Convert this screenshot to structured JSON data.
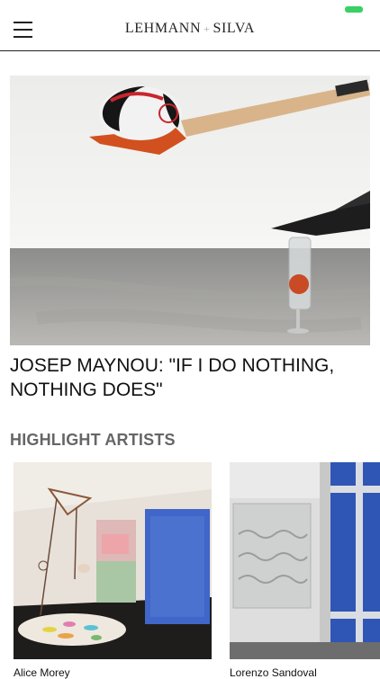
{
  "header": {
    "brand_left": "LEHMANN",
    "brand_sep": "+",
    "brand_right": "SILVA",
    "menu_icon": "hamburger-menu-icon"
  },
  "hero": {
    "title": "JOSEP MAYNOU: \"IF I DO NOTHING, NOTHING DOES\"",
    "image": "exhibition-installation-photo"
  },
  "highlights": {
    "title": "HIGHLIGHT ARTISTS",
    "artists": [
      {
        "name": "Alice Morey"
      },
      {
        "name": "Lorenzo Sandoval"
      }
    ]
  },
  "colors": {
    "status_indicator": "#39d165",
    "section_title": "#666666"
  }
}
